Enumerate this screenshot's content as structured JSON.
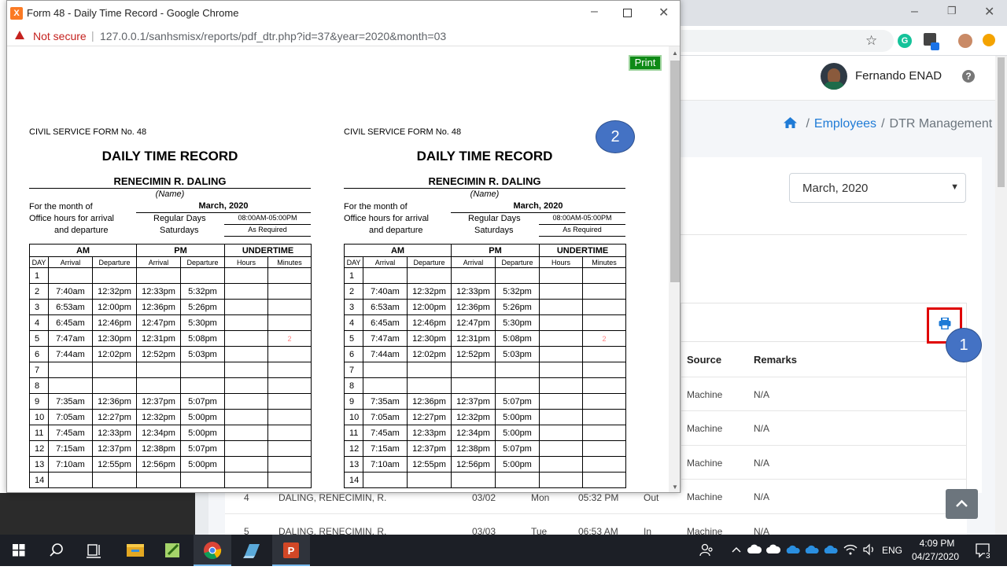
{
  "popup": {
    "title": "Form 48 - Daily Time Record - Google Chrome",
    "not_secure": "Not secure",
    "url": "127.0.0.1/sanhsmisx/reports/pdf_dtr.php?id=37&year=2020&month=03",
    "print_label": "Print"
  },
  "form": {
    "csf": "CIVIL SERVICE FORM No. 48",
    "title": "DAILY TIME RECORD",
    "name": "RENECIMIN R. DALING",
    "name_label": "(Name)",
    "month_label": "For the month of",
    "month_value": "March, 2020",
    "office_hours_1": "Office hours for arrival",
    "office_hours_2": "and departure",
    "regular_days": "Regular Days",
    "regular_hours": "08:00AM-05:00PM",
    "saturdays": "Saturdays",
    "saturday_hours": "As Required",
    "head_am": "AM",
    "head_pm": "PM",
    "head_undertime": "UNDERTIME",
    "col_day": "DAY",
    "col_arrival": "Arrival",
    "col_departure": "Departure",
    "col_hours": "Hours",
    "col_minutes": "Minutes",
    "rows": [
      {
        "day": "1",
        "am_in": "",
        "am_out": "",
        "pm_in": "",
        "pm_out": "",
        "hours": "",
        "minutes": ""
      },
      {
        "day": "2",
        "am_in": "7:40am",
        "am_out": "12:32pm",
        "pm_in": "12:33pm",
        "pm_out": "5:32pm",
        "hours": "",
        "minutes": ""
      },
      {
        "day": "3",
        "am_in": "6:53am",
        "am_out": "12:00pm",
        "pm_in": "12:36pm",
        "pm_out": "5:26pm",
        "hours": "",
        "minutes": ""
      },
      {
        "day": "4",
        "am_in": "6:45am",
        "am_out": "12:46pm",
        "pm_in": "12:47pm",
        "pm_out": "5:30pm",
        "hours": "",
        "minutes": ""
      },
      {
        "day": "5",
        "am_in": "7:47am",
        "am_out": "12:30pm",
        "pm_in": "12:31pm",
        "pm_out": "5:08pm",
        "hours": "",
        "minutes": "2"
      },
      {
        "day": "6",
        "am_in": "7:44am",
        "am_out": "12:02pm",
        "pm_in": "12:52pm",
        "pm_out": "5:03pm",
        "hours": "",
        "minutes": ""
      },
      {
        "day": "7",
        "am_in": "",
        "am_out": "",
        "pm_in": "",
        "pm_out": "",
        "hours": "",
        "minutes": ""
      },
      {
        "day": "8",
        "am_in": "",
        "am_out": "",
        "pm_in": "",
        "pm_out": "",
        "hours": "",
        "minutes": ""
      },
      {
        "day": "9",
        "am_in": "7:35am",
        "am_out": "12:36pm",
        "pm_in": "12:37pm",
        "pm_out": "5:07pm",
        "hours": "",
        "minutes": ""
      },
      {
        "day": "10",
        "am_in": "7:05am",
        "am_out": "12:27pm",
        "pm_in": "12:32pm",
        "pm_out": "5:00pm",
        "hours": "",
        "minutes": ""
      },
      {
        "day": "11",
        "am_in": "7:45am",
        "am_out": "12:33pm",
        "pm_in": "12:34pm",
        "pm_out": "5:00pm",
        "hours": "",
        "minutes": ""
      },
      {
        "day": "12",
        "am_in": "7:15am",
        "am_out": "12:37pm",
        "pm_in": "12:38pm",
        "pm_out": "5:07pm",
        "hours": "",
        "minutes": ""
      },
      {
        "day": "13",
        "am_in": "7:10am",
        "am_out": "12:55pm",
        "pm_in": "12:56pm",
        "pm_out": "5:00pm",
        "hours": "",
        "minutes": ""
      },
      {
        "day": "14",
        "am_in": "",
        "am_out": "",
        "pm_in": "",
        "pm_out": "",
        "hours": "",
        "minutes": ""
      }
    ]
  },
  "callouts": {
    "one": "1",
    "two": "2"
  },
  "app": {
    "username": "Fernando ENAD",
    "breadcrumb_employees": "Employees",
    "breadcrumb_current": "DTR Management",
    "month_selected": "March, 2020",
    "col_source": "Source",
    "col_remarks": "Remarks",
    "rows": [
      {
        "source": "Machine",
        "remarks": "N/A"
      },
      {
        "source": "Machine",
        "remarks": "N/A"
      },
      {
        "source": "Machine",
        "remarks": "N/A"
      },
      {
        "no": "4",
        "name": "DALING, RENECIMIN, R.",
        "date": "03/02",
        "dow": "Mon",
        "time": "05:32 PM",
        "type": "Out",
        "source": "Machine",
        "remarks": "N/A"
      },
      {
        "no": "5",
        "name": "DALING, RENECIMIN, R.",
        "date": "03/03",
        "dow": "Tue",
        "time": "06:53 AM",
        "type": "In",
        "source": "Machine",
        "remarks": "N/A"
      }
    ]
  },
  "taskbar": {
    "language": "ENG",
    "time": "4:09 PM",
    "date": "04/27/2020",
    "notification_count": "3"
  },
  "colors": {
    "accent": "#1f7bd6",
    "callout": "#4472c4",
    "print_green": "#0e8a16",
    "highlight_red": "#e00000"
  }
}
